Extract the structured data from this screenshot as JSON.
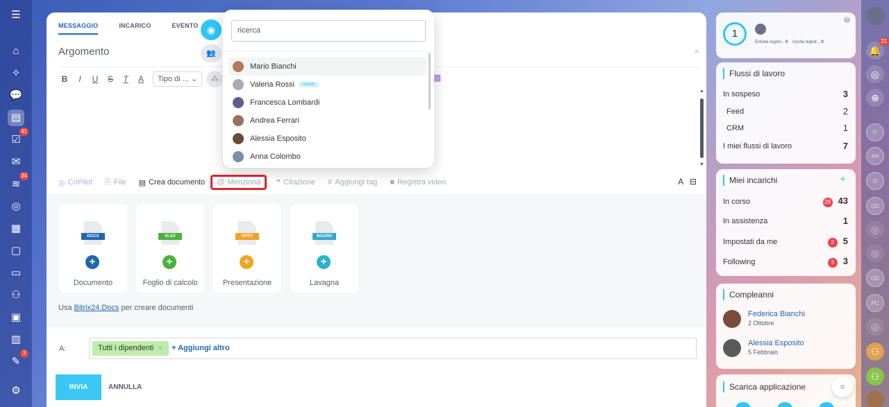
{
  "sidebar_left": {
    "badges": {
      "tasks": "41",
      "feed": "34",
      "workflows": "3"
    }
  },
  "composer": {
    "tabs": [
      "MESSAGGIO",
      "INCARICO",
      "EVENTO"
    ],
    "subject_placeholder": "Argomento",
    "format_select": "Tipo di ...",
    "toolbar": {
      "copilot": "CoPilot",
      "file": "File",
      "create_doc": "Crea documento",
      "mention": "Menziona",
      "quote": "Citazione",
      "tag": "Aggiungi tag",
      "video": "Registra video",
      "font_icon": "A"
    },
    "docs": [
      {
        "tag": "DOCX",
        "label": "Documento",
        "color": "#2067b0",
        "plus": "#2067b0"
      },
      {
        "tag": "XLSX",
        "label": "Foglio di calcolo",
        "color": "#4cb13c",
        "plus": "#4cb13c"
      },
      {
        "tag": "PPTX",
        "label": "Presentazione",
        "color": "#f1a325",
        "plus": "#f1a325"
      },
      {
        "tag": "BOARD",
        "label": "Lavagna",
        "color": "#33a8c4",
        "plus": "#2bb3c8"
      }
    ],
    "docs_note_prefix": "Usa ",
    "docs_note_link": "Bitrix24.Docs",
    "docs_note_suffix": " per creare documenti",
    "to_label": "A:",
    "recipient_chip": "Tutti i dipendenti",
    "add_more": "+ Aggiungi altro",
    "send": "INVIA",
    "cancel": "ANNULLA"
  },
  "mention_popup": {
    "search_value": "ricerca",
    "people": [
      {
        "name": "Mario Bianchi",
        "badge": "",
        "color": "#b47a5a"
      },
      {
        "name": "Valeria Rossi",
        "badge": "Invitati",
        "color": "#a7adb4"
      },
      {
        "name": "Francesca Lombardi",
        "badge": "",
        "color": "#5a5f8a"
      },
      {
        "name": "Andrea Ferrari",
        "badge": "",
        "color": "#9a7060"
      },
      {
        "name": "Alessia Esposito",
        "badge": "",
        "color": "#6a4a3a"
      },
      {
        "name": "Anna Colombo",
        "badge": "",
        "color": "#7c8ea8"
      }
    ]
  },
  "widgets": {
    "stats": {
      "count": "1",
      "in_label": "Entrata registr...",
      "in_value": "0",
      "out_label": "Uscita registr...",
      "out_value": "0"
    },
    "workflows": {
      "title": "Flussi di lavoro",
      "rows": [
        {
          "label": "In sospeso",
          "value": "3"
        },
        {
          "label": "Feed",
          "value": "2"
        },
        {
          "label": "CRM",
          "value": "1"
        },
        {
          "label": "I miei flussi di lavoro",
          "value": "7"
        }
      ]
    },
    "tasks": {
      "title": "Miei incarichi",
      "add": "+",
      "rows": [
        {
          "label": "In corso",
          "badge": "29",
          "value": "43"
        },
        {
          "label": "In assistenza",
          "badge": "",
          "value": "1"
        },
        {
          "label": "Impostati da me",
          "badge": "2",
          "value": "5"
        },
        {
          "label": "Following",
          "badge": "3",
          "value": "3"
        }
      ]
    },
    "birthdays": {
      "title": "Compleanni",
      "people": [
        {
          "name": "Federica Bianchi",
          "date": "2 Ottobre"
        },
        {
          "name": "Alessia Esposito",
          "date": "5 Febbraio"
        }
      ]
    },
    "download": {
      "title": "Scarica applicazione"
    }
  },
  "sidebar_right": {
    "notifications_badge": "21",
    "avatars": [
      "IT",
      "AA",
      "D",
      "GD",
      "OD",
      "PC"
    ]
  }
}
